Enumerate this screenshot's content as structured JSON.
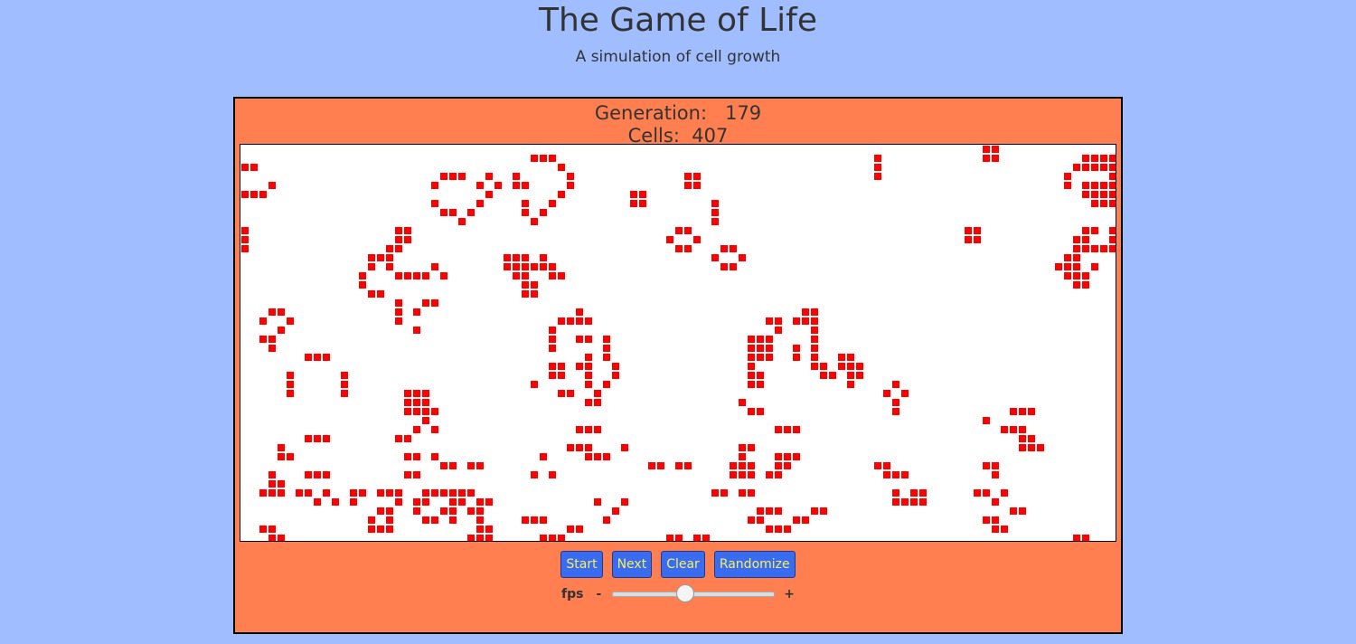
{
  "header": {
    "title": "The Game of Life",
    "subtitle": "A simulation of cell growth"
  },
  "stats": {
    "generation_label": "Generation:",
    "generation": "179",
    "cells_label": "Cells:",
    "cells": "407"
  },
  "board": {
    "columns": 97,
    "rows": 44,
    "live_color": "#ff0000",
    "background_color": "#ffffff",
    "live_cells": [
      [
        82,
        0
      ],
      [
        83,
        0
      ],
      [
        32,
        1
      ],
      [
        33,
        1
      ],
      [
        34,
        1
      ],
      [
        70,
        1
      ],
      [
        82,
        1
      ],
      [
        83,
        1
      ],
      [
        93,
        1
      ],
      [
        94,
        1
      ],
      [
        95,
        1
      ],
      [
        96,
        1
      ],
      [
        0,
        2
      ],
      [
        1,
        2
      ],
      [
        35,
        2
      ],
      [
        70,
        2
      ],
      [
        92,
        2
      ],
      [
        93,
        2
      ],
      [
        94,
        2
      ],
      [
        95,
        2
      ],
      [
        96,
        2
      ],
      [
        22,
        3
      ],
      [
        23,
        3
      ],
      [
        24,
        3
      ],
      [
        27,
        3
      ],
      [
        30,
        3
      ],
      [
        36,
        3
      ],
      [
        49,
        3
      ],
      [
        50,
        3
      ],
      [
        70,
        3
      ],
      [
        91,
        3
      ],
      [
        96,
        3
      ],
      [
        3,
        4
      ],
      [
        21,
        4
      ],
      [
        26,
        4
      ],
      [
        28,
        4
      ],
      [
        30,
        4
      ],
      [
        31,
        4
      ],
      [
        36,
        4
      ],
      [
        49,
        4
      ],
      [
        50,
        4
      ],
      [
        91,
        4
      ],
      [
        93,
        4
      ],
      [
        94,
        4
      ],
      [
        95,
        4
      ],
      [
        96,
        4
      ],
      [
        0,
        5
      ],
      [
        1,
        5
      ],
      [
        2,
        5
      ],
      [
        27,
        5
      ],
      [
        35,
        5
      ],
      [
        43,
        5
      ],
      [
        44,
        5
      ],
      [
        93,
        5
      ],
      [
        94,
        5
      ],
      [
        95,
        5
      ],
      [
        96,
        5
      ],
      [
        21,
        6
      ],
      [
        26,
        6
      ],
      [
        31,
        6
      ],
      [
        34,
        6
      ],
      [
        43,
        6
      ],
      [
        44,
        6
      ],
      [
        52,
        6
      ],
      [
        94,
        6
      ],
      [
        95,
        6
      ],
      [
        96,
        6
      ],
      [
        22,
        7
      ],
      [
        23,
        7
      ],
      [
        25,
        7
      ],
      [
        31,
        7
      ],
      [
        33,
        7
      ],
      [
        52,
        7
      ],
      [
        24,
        8
      ],
      [
        32,
        8
      ],
      [
        52,
        8
      ],
      [
        0,
        9
      ],
      [
        17,
        9
      ],
      [
        18,
        9
      ],
      [
        48,
        9
      ],
      [
        49,
        9
      ],
      [
        80,
        9
      ],
      [
        81,
        9
      ],
      [
        93,
        9
      ],
      [
        94,
        9
      ],
      [
        96,
        9
      ],
      [
        0,
        10
      ],
      [
        17,
        10
      ],
      [
        18,
        10
      ],
      [
        47,
        10
      ],
      [
        50,
        10
      ],
      [
        80,
        10
      ],
      [
        81,
        10
      ],
      [
        92,
        10
      ],
      [
        93,
        10
      ],
      [
        96,
        10
      ],
      [
        0,
        11
      ],
      [
        16,
        11
      ],
      [
        17,
        11
      ],
      [
        48,
        11
      ],
      [
        49,
        11
      ],
      [
        53,
        11
      ],
      [
        54,
        11
      ],
      [
        92,
        11
      ],
      [
        93,
        11
      ],
      [
        94,
        11
      ],
      [
        95,
        11
      ],
      [
        96,
        11
      ],
      [
        14,
        12
      ],
      [
        15,
        12
      ],
      [
        16,
        12
      ],
      [
        29,
        12
      ],
      [
        30,
        12
      ],
      [
        31,
        12
      ],
      [
        33,
        12
      ],
      [
        52,
        12
      ],
      [
        55,
        12
      ],
      [
        91,
        12
      ],
      [
        92,
        12
      ],
      [
        14,
        13
      ],
      [
        16,
        13
      ],
      [
        21,
        13
      ],
      [
        29,
        13
      ],
      [
        30,
        13
      ],
      [
        31,
        13
      ],
      [
        32,
        13
      ],
      [
        33,
        13
      ],
      [
        34,
        13
      ],
      [
        53,
        13
      ],
      [
        54,
        13
      ],
      [
        90,
        13
      ],
      [
        91,
        13
      ],
      [
        92,
        13
      ],
      [
        94,
        13
      ],
      [
        13,
        14
      ],
      [
        17,
        14
      ],
      [
        18,
        14
      ],
      [
        19,
        14
      ],
      [
        20,
        14
      ],
      [
        22,
        14
      ],
      [
        30,
        14
      ],
      [
        31,
        14
      ],
      [
        34,
        14
      ],
      [
        35,
        14
      ],
      [
        91,
        14
      ],
      [
        92,
        14
      ],
      [
        93,
        14
      ],
      [
        13,
        15
      ],
      [
        31,
        15
      ],
      [
        32,
        15
      ],
      [
        92,
        15
      ],
      [
        93,
        15
      ],
      [
        14,
        16
      ],
      [
        15,
        16
      ],
      [
        31,
        16
      ],
      [
        32,
        16
      ],
      [
        17,
        17
      ],
      [
        20,
        17
      ],
      [
        21,
        17
      ],
      [
        3,
        18
      ],
      [
        4,
        18
      ],
      [
        17,
        18
      ],
      [
        19,
        18
      ],
      [
        37,
        18
      ],
      [
        62,
        18
      ],
      [
        63,
        18
      ],
      [
        2,
        19
      ],
      [
        5,
        19
      ],
      [
        17,
        19
      ],
      [
        35,
        19
      ],
      [
        36,
        19
      ],
      [
        37,
        19
      ],
      [
        38,
        19
      ],
      [
        58,
        19
      ],
      [
        59,
        19
      ],
      [
        61,
        19
      ],
      [
        62,
        19
      ],
      [
        63,
        19
      ],
      [
        4,
        20
      ],
      [
        19,
        20
      ],
      [
        34,
        20
      ],
      [
        59,
        20
      ],
      [
        63,
        20
      ],
      [
        2,
        21
      ],
      [
        3,
        21
      ],
      [
        34,
        21
      ],
      [
        37,
        21
      ],
      [
        38,
        21
      ],
      [
        40,
        21
      ],
      [
        56,
        21
      ],
      [
        57,
        21
      ],
      [
        58,
        21
      ],
      [
        63,
        21
      ],
      [
        3,
        22
      ],
      [
        34,
        22
      ],
      [
        40,
        22
      ],
      [
        56,
        22
      ],
      [
        57,
        22
      ],
      [
        58,
        22
      ],
      [
        61,
        22
      ],
      [
        63,
        22
      ],
      [
        7,
        23
      ],
      [
        8,
        23
      ],
      [
        9,
        23
      ],
      [
        38,
        23
      ],
      [
        40,
        23
      ],
      [
        56,
        23
      ],
      [
        57,
        23
      ],
      [
        58,
        23
      ],
      [
        61,
        23
      ],
      [
        63,
        23
      ],
      [
        66,
        23
      ],
      [
        67,
        23
      ],
      [
        34,
        24
      ],
      [
        35,
        24
      ],
      [
        37,
        24
      ],
      [
        38,
        24
      ],
      [
        41,
        24
      ],
      [
        56,
        24
      ],
      [
        63,
        24
      ],
      [
        64,
        24
      ],
      [
        66,
        24
      ],
      [
        67,
        24
      ],
      [
        68,
        24
      ],
      [
        5,
        25
      ],
      [
        11,
        25
      ],
      [
        34,
        25
      ],
      [
        35,
        25
      ],
      [
        38,
        25
      ],
      [
        41,
        25
      ],
      [
        56,
        25
      ],
      [
        57,
        25
      ],
      [
        64,
        25
      ],
      [
        65,
        25
      ],
      [
        67,
        25
      ],
      [
        68,
        25
      ],
      [
        5,
        26
      ],
      [
        11,
        26
      ],
      [
        32,
        26
      ],
      [
        38,
        26
      ],
      [
        40,
        26
      ],
      [
        56,
        26
      ],
      [
        57,
        26
      ],
      [
        67,
        26
      ],
      [
        72,
        26
      ],
      [
        5,
        27
      ],
      [
        11,
        27
      ],
      [
        18,
        27
      ],
      [
        19,
        27
      ],
      [
        20,
        27
      ],
      [
        35,
        27
      ],
      [
        36,
        27
      ],
      [
        39,
        27
      ],
      [
        71,
        27
      ],
      [
        73,
        27
      ],
      [
        18,
        28
      ],
      [
        19,
        28
      ],
      [
        20,
        28
      ],
      [
        38,
        28
      ],
      [
        39,
        28
      ],
      [
        55,
        28
      ],
      [
        72,
        28
      ],
      [
        18,
        29
      ],
      [
        19,
        29
      ],
      [
        20,
        29
      ],
      [
        21,
        29
      ],
      [
        56,
        29
      ],
      [
        57,
        29
      ],
      [
        85,
        29
      ],
      [
        86,
        29
      ],
      [
        87,
        29
      ],
      [
        72,
        29
      ],
      [
        20,
        30
      ],
      [
        82,
        30
      ],
      [
        19,
        31
      ],
      [
        21,
        31
      ],
      [
        37,
        31
      ],
      [
        38,
        31
      ],
      [
        39,
        31
      ],
      [
        59,
        31
      ],
      [
        60,
        31
      ],
      [
        61,
        31
      ],
      [
        84,
        31
      ],
      [
        85,
        31
      ],
      [
        86,
        31
      ],
      [
        7,
        32
      ],
      [
        8,
        32
      ],
      [
        9,
        32
      ],
      [
        17,
        32
      ],
      [
        18,
        32
      ],
      [
        86,
        32
      ],
      [
        87,
        32
      ],
      [
        4,
        33
      ],
      [
        36,
        33
      ],
      [
        37,
        33
      ],
      [
        38,
        33
      ],
      [
        42,
        33
      ],
      [
        55,
        33
      ],
      [
        56,
        33
      ],
      [
        86,
        33
      ],
      [
        87,
        33
      ],
      [
        88,
        33
      ],
      [
        4,
        34
      ],
      [
        5,
        34
      ],
      [
        18,
        34
      ],
      [
        19,
        34
      ],
      [
        21,
        34
      ],
      [
        33,
        34
      ],
      [
        38,
        34
      ],
      [
        39,
        34
      ],
      [
        40,
        34
      ],
      [
        55,
        34
      ],
      [
        59,
        34
      ],
      [
        60,
        34
      ],
      [
        61,
        34
      ],
      [
        22,
        35
      ],
      [
        23,
        35
      ],
      [
        25,
        35
      ],
      [
        26,
        35
      ],
      [
        45,
        35
      ],
      [
        46,
        35
      ],
      [
        48,
        35
      ],
      [
        49,
        35
      ],
      [
        54,
        35
      ],
      [
        55,
        35
      ],
      [
        56,
        35
      ],
      [
        59,
        35
      ],
      [
        60,
        35
      ],
      [
        70,
        35
      ],
      [
        71,
        35
      ],
      [
        82,
        35
      ],
      [
        83,
        35
      ],
      [
        3,
        36
      ],
      [
        3,
        37
      ],
      [
        4,
        37
      ],
      [
        7,
        36
      ],
      [
        8,
        36
      ],
      [
        9,
        36
      ],
      [
        18,
        36
      ],
      [
        19,
        36
      ],
      [
        32,
        36
      ],
      [
        34,
        36
      ],
      [
        54,
        36
      ],
      [
        55,
        36
      ],
      [
        56,
        36
      ],
      [
        58,
        36
      ],
      [
        59,
        36
      ],
      [
        71,
        36
      ],
      [
        72,
        36
      ],
      [
        73,
        36
      ],
      [
        83,
        36
      ],
      [
        2,
        38
      ],
      [
        3,
        38
      ],
      [
        4,
        38
      ],
      [
        6,
        38
      ],
      [
        7,
        38
      ],
      [
        9,
        38
      ],
      [
        12,
        38
      ],
      [
        13,
        38
      ],
      [
        15,
        38
      ],
      [
        16,
        38
      ],
      [
        17,
        38
      ],
      [
        20,
        38
      ],
      [
        21,
        38
      ],
      [
        22,
        38
      ],
      [
        23,
        38
      ],
      [
        24,
        38
      ],
      [
        25,
        38
      ],
      [
        52,
        38
      ],
      [
        53,
        38
      ],
      [
        55,
        38
      ],
      [
        56,
        38
      ],
      [
        72,
        38
      ],
      [
        74,
        38
      ],
      [
        75,
        38
      ],
      [
        81,
        38
      ],
      [
        82,
        38
      ],
      [
        84,
        38
      ],
      [
        8,
        39
      ],
      [
        10,
        39
      ],
      [
        12,
        39
      ],
      [
        17,
        39
      ],
      [
        19,
        39
      ],
      [
        20,
        39
      ],
      [
        23,
        39
      ],
      [
        24,
        39
      ],
      [
        26,
        39
      ],
      [
        27,
        39
      ],
      [
        39,
        39
      ],
      [
        42,
        39
      ],
      [
        72,
        39
      ],
      [
        73,
        39
      ],
      [
        74,
        39
      ],
      [
        75,
        39
      ],
      [
        83,
        39
      ],
      [
        15,
        40
      ],
      [
        16,
        40
      ],
      [
        19,
        40
      ],
      [
        22,
        40
      ],
      [
        23,
        40
      ],
      [
        25,
        40
      ],
      [
        26,
        40
      ],
      [
        41,
        40
      ],
      [
        57,
        40
      ],
      [
        58,
        40
      ],
      [
        59,
        40
      ],
      [
        63,
        40
      ],
      [
        64,
        40
      ],
      [
        85,
        40
      ],
      [
        86,
        40
      ],
      [
        14,
        41
      ],
      [
        16,
        41
      ],
      [
        20,
        41
      ],
      [
        21,
        41
      ],
      [
        23,
        41
      ],
      [
        26,
        41
      ],
      [
        31,
        41
      ],
      [
        32,
        41
      ],
      [
        33,
        41
      ],
      [
        40,
        41
      ],
      [
        56,
        41
      ],
      [
        57,
        41
      ],
      [
        61,
        41
      ],
      [
        62,
        41
      ],
      [
        82,
        41
      ],
      [
        83,
        41
      ],
      [
        2,
        42
      ],
      [
        3,
        42
      ],
      [
        14,
        42
      ],
      [
        15,
        42
      ],
      [
        16,
        42
      ],
      [
        26,
        42
      ],
      [
        27,
        42
      ],
      [
        36,
        42
      ],
      [
        37,
        42
      ],
      [
        58,
        42
      ],
      [
        59,
        42
      ],
      [
        60,
        42
      ],
      [
        83,
        42
      ],
      [
        84,
        42
      ],
      [
        3,
        43
      ],
      [
        4,
        43
      ],
      [
        25,
        43
      ],
      [
        26,
        43
      ],
      [
        27,
        43
      ],
      [
        33,
        43
      ],
      [
        34,
        43
      ],
      [
        35,
        43
      ],
      [
        47,
        43
      ],
      [
        48,
        43
      ],
      [
        50,
        43
      ],
      [
        51,
        43
      ],
      [
        92,
        43
      ],
      [
        93,
        43
      ]
    ]
  },
  "controls": {
    "start_label": "Start",
    "next_label": "Next",
    "clear_label": "Clear",
    "randomize_label": "Randomize",
    "button_color": "#3a6cf2",
    "button_text_color": "#f5f05a"
  },
  "fps": {
    "label": "fps",
    "minus": "-",
    "plus": "+",
    "slider_fraction": 0.45
  },
  "colors": {
    "page_background": "#9fbdff",
    "panel_background": "#ff7f50",
    "text": "#333333"
  }
}
